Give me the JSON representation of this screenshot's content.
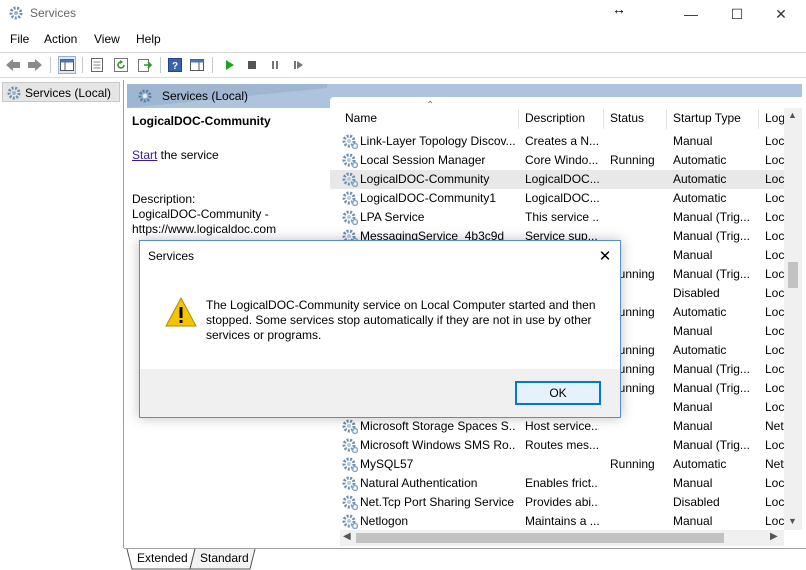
{
  "window": {
    "title": "Services",
    "minimize_glyph": "—",
    "maximize_glyph": "☐",
    "close_glyph": "✕",
    "resize_cursor_glyph": "↔"
  },
  "menu": [
    "File",
    "Action",
    "View",
    "Help"
  ],
  "toolbar": {
    "icons": [
      "back-arrow-icon",
      "forward-arrow-icon",
      "show-hide-console-tree-icon",
      "properties-icon",
      "refresh-icon",
      "export-list-icon",
      "help-icon",
      "show-action-pane-icon",
      "start-service-icon",
      "stop-service-icon",
      "pause-service-icon",
      "resume-service-icon"
    ]
  },
  "tree": {
    "item": "Services (Local)"
  },
  "header": {
    "label": "Services (Local)"
  },
  "description_pane": {
    "service_name": "LogicalDOC-Community",
    "start_link": "Start",
    "start_suffix": " the service",
    "description_label": "Description:",
    "description_text": "LogicalDOC-Community - https://www.logicaldoc.com"
  },
  "columns": [
    "Name",
    "Description",
    "Status",
    "Startup Type",
    "Log"
  ],
  "rows": [
    {
      "name": "Link-Layer Topology Discov...",
      "desc": "Creates a N...",
      "status": "",
      "startup": "Manual",
      "log": "Loc"
    },
    {
      "name": "Local Session Manager",
      "desc": "Core Windo...",
      "status": "Running",
      "startup": "Automatic",
      "log": "Loc"
    },
    {
      "name": "LogicalDOC-Community",
      "desc": "LogicalDOC...",
      "status": "",
      "startup": "Automatic",
      "log": "Loc"
    },
    {
      "name": "LogicalDOC-Community1",
      "desc": "LogicalDOC...",
      "status": "",
      "startup": "Automatic",
      "log": "Loc"
    },
    {
      "name": "LPA Service",
      "desc": "This service ...",
      "status": "",
      "startup": "Manual (Trig...",
      "log": "Loc"
    },
    {
      "name": "MessagingService_4b3c9d",
      "desc": "Service sup...",
      "status": "",
      "startup": "Manual (Trig...",
      "log": "Loc"
    },
    {
      "name": "",
      "desc": "",
      "status": "",
      "startup": "Manual",
      "log": "Loc"
    },
    {
      "name": "",
      "desc": "",
      "status": "Running",
      "startup": "Manual (Trig...",
      "log": "Loc"
    },
    {
      "name": "",
      "desc": "",
      "status": "",
      "startup": "Disabled",
      "log": "Loc"
    },
    {
      "name": "",
      "desc": "",
      "status": "Running",
      "startup": "Automatic",
      "log": "Loc"
    },
    {
      "name": "",
      "desc": "",
      "status": "",
      "startup": "Manual",
      "log": "Loc"
    },
    {
      "name": "",
      "desc": "",
      "status": "Running",
      "startup": "Automatic",
      "log": "Loc"
    },
    {
      "name": "",
      "desc": "",
      "status": "Running",
      "startup": "Manual (Trig...",
      "log": "Loc"
    },
    {
      "name": "",
      "desc": "",
      "status": "Running",
      "startup": "Manual (Trig...",
      "log": "Loc"
    },
    {
      "name": "",
      "desc": "",
      "status": "",
      "startup": "Manual",
      "log": "Loc"
    },
    {
      "name": "Microsoft Storage Spaces S...",
      "desc": "Host service...",
      "status": "",
      "startup": "Manual",
      "log": "Net"
    },
    {
      "name": "Microsoft Windows SMS Ro...",
      "desc": "Routes mes...",
      "status": "",
      "startup": "Manual (Trig...",
      "log": "Loc"
    },
    {
      "name": "MySQL57",
      "desc": "",
      "status": "Running",
      "startup": "Automatic",
      "log": "Net"
    },
    {
      "name": "Natural Authentication",
      "desc": "Enables frict...",
      "status": "",
      "startup": "Manual",
      "log": "Loc"
    },
    {
      "name": "Net.Tcp Port Sharing Service",
      "desc": "Provides abi...",
      "status": "",
      "startup": "Disabled",
      "log": "Loc"
    },
    {
      "name": "Netlogon",
      "desc": "Maintains a ...",
      "status": "",
      "startup": "Manual",
      "log": "Loc"
    }
  ],
  "selected_row": 2,
  "tabs": [
    "Extended",
    "Standard"
  ],
  "dialog": {
    "title": "Services",
    "close_glyph": "✕",
    "message": "The LogicalDOC-Community service on Local Computer started and then stopped. Some services stop automatically if they are not in use by other services or programs.",
    "ok_label": "OK"
  },
  "colors": {
    "header_band": "#aec4dc",
    "link": "#3c1a9c",
    "dialog_border": "#5a8ecb",
    "ok_border": "#0078d7",
    "warning": "#f5c400"
  }
}
